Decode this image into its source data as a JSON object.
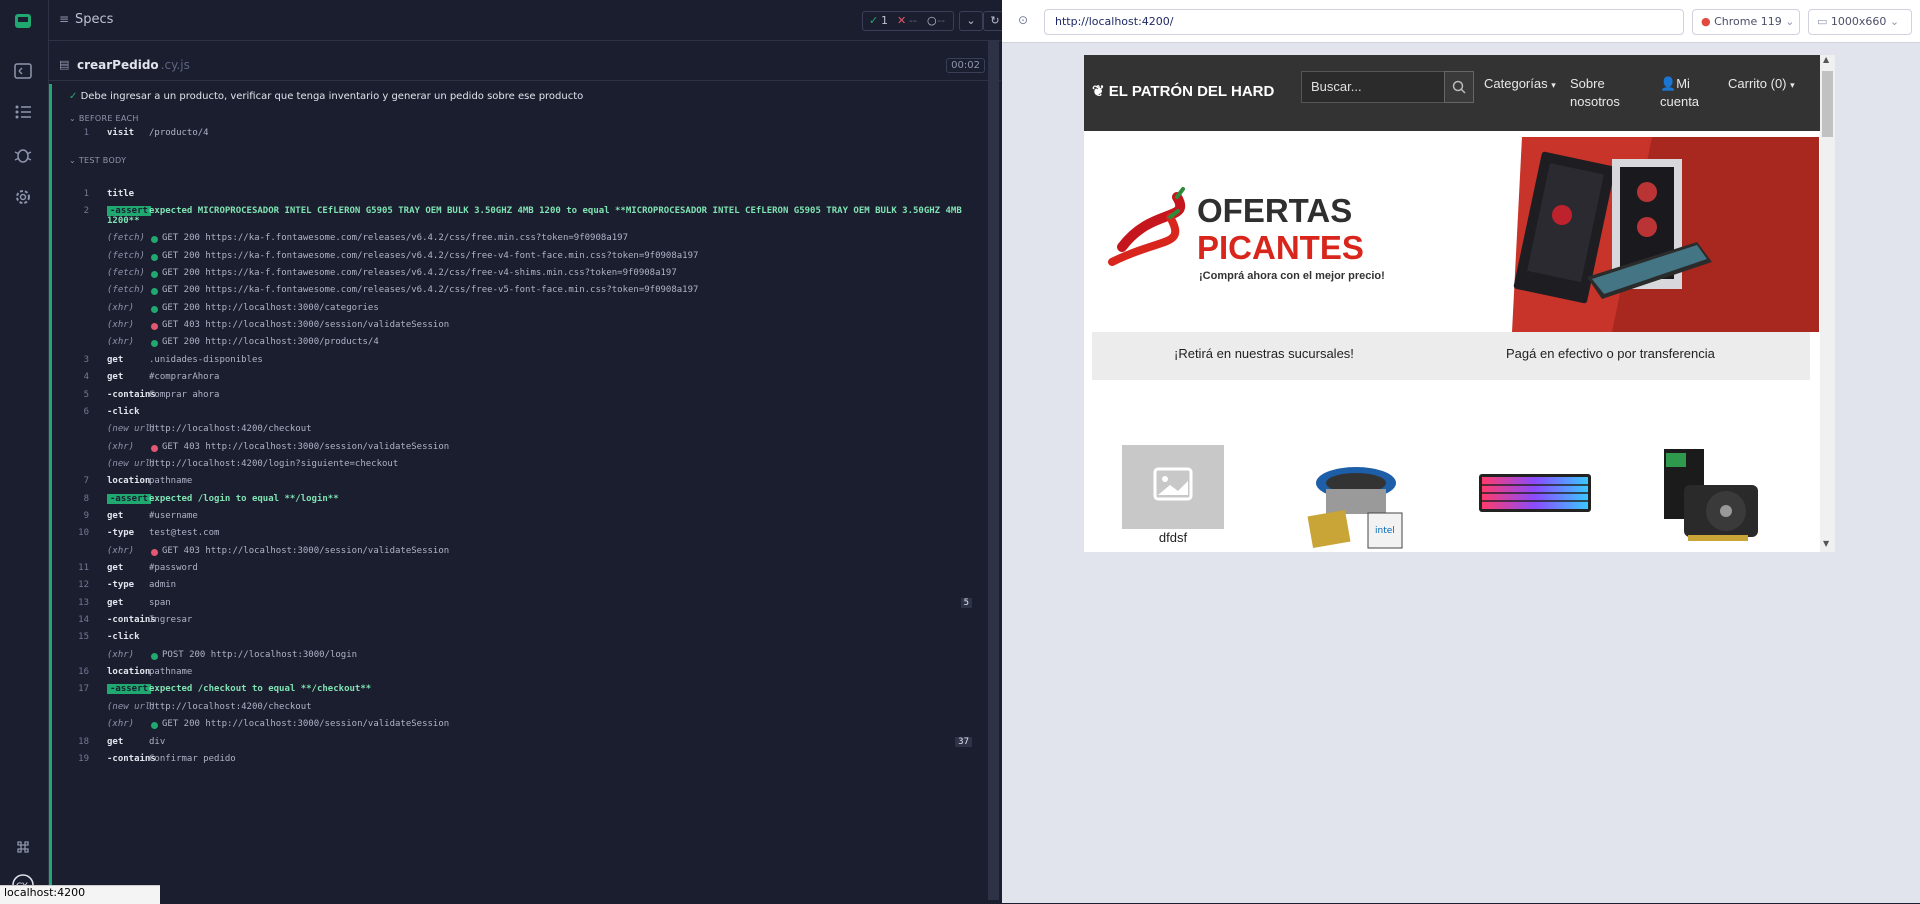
{
  "sidenav": {
    "items": [
      "logo",
      "specs",
      "runs",
      "debug",
      "settings",
      "keyboard",
      "cypress-logo"
    ]
  },
  "specs_bar": {
    "title": "Specs",
    "passed": "1",
    "failed": "--",
    "pending": "--"
  },
  "file": {
    "name": "crearPedido",
    "ext": ".cy.js",
    "duration": "00:02"
  },
  "test": {
    "title": "Debe ingresar a un producto, verificar que tenga inventario y generar un pedido sobre ese producto"
  },
  "sections": {
    "before_each": "BEFORE EACH",
    "test_body": "TEST BODY"
  },
  "commands": [
    {
      "num": "1",
      "name": "visit",
      "msg": "/producto/4",
      "sub": false
    },
    {
      "num": "1",
      "name": "title",
      "msg": "",
      "sub": false
    },
    {
      "num": "2",
      "name": "-assert",
      "msg": "expected MICROPROCESADOR INTEL CEfLERON G5905 TRAY OEM BULK 3.50GHZ 4MB 1200 to equal **MICROPROCESADOR INTEL CEfLERON G5905 TRAY OEM BULK 3.50GHZ 4MB",
      "msg2": "1200**",
      "sub": false
    },
    {
      "num": "",
      "name": "(fetch)",
      "msg": "GET 200 https://ka-f.fontawesome.com/releases/v6.4.2/css/free.min.css?token=9f0908a197",
      "sub": true,
      "dot": "#1fa971"
    },
    {
      "num": "",
      "name": "(fetch)",
      "msg": "GET 200 https://ka-f.fontawesome.com/releases/v6.4.2/css/free-v4-font-face.min.css?token=9f0908a197",
      "sub": true,
      "dot": "#1fa971"
    },
    {
      "num": "",
      "name": "(fetch)",
      "msg": "GET 200 https://ka-f.fontawesome.com/releases/v6.4.2/css/free-v4-shims.min.css?token=9f0908a197",
      "sub": true,
      "dot": "#1fa971"
    },
    {
      "num": "",
      "name": "(fetch)",
      "msg": "GET 200 https://ka-f.fontawesome.com/releases/v6.4.2/css/free-v5-font-face.min.css?token=9f0908a197",
      "sub": true,
      "dot": "#1fa971"
    },
    {
      "num": "",
      "name": "(xhr)",
      "msg": "GET 200 http://localhost:3000/categories",
      "sub": true,
      "dot": "#1fa971"
    },
    {
      "num": "",
      "name": "(xhr)",
      "msg": "GET 403 http://localhost:3000/session/validateSession",
      "sub": true,
      "dot": "#e45770"
    },
    {
      "num": "",
      "name": "(xhr)",
      "msg": "GET 200 http://localhost:3000/products/4",
      "sub": true,
      "dot": "#1fa971"
    },
    {
      "num": "3",
      "name": "get",
      "msg": ".unidades-disponibles",
      "sub": false
    },
    {
      "num": "4",
      "name": "get",
      "msg": "#comprarAhora",
      "sub": false
    },
    {
      "num": "5",
      "name": "-contains",
      "msg": "Comprar ahora",
      "sub": false
    },
    {
      "num": "6",
      "name": "-click",
      "msg": "",
      "sub": false
    },
    {
      "num": "",
      "name": "(new url)",
      "msg": "http://localhost:4200/checkout",
      "sub": true
    },
    {
      "num": "",
      "name": "(xhr)",
      "msg": "GET 403 http://localhost:3000/session/validateSession",
      "sub": true,
      "dot": "#e45770"
    },
    {
      "num": "",
      "name": "(new url)",
      "msg": "http://localhost:4200/login?siguiente=checkout",
      "sub": true
    },
    {
      "num": "7",
      "name": "location",
      "msg": "pathname",
      "sub": false
    },
    {
      "num": "8",
      "name": "-assert",
      "msg": "expected /login to equal **/login**",
      "sub": false
    },
    {
      "num": "9",
      "name": "get",
      "msg": "#username",
      "sub": false
    },
    {
      "num": "10",
      "name": "-type",
      "msg": "test@test.com",
      "sub": false
    },
    {
      "num": "",
      "name": "(xhr)",
      "msg": "GET 403 http://localhost:3000/session/validateSession",
      "sub": true,
      "dot": "#e45770"
    },
    {
      "num": "11",
      "name": "get",
      "msg": "#password",
      "sub": false
    },
    {
      "num": "12",
      "name": "-type",
      "msg": "admin",
      "sub": false
    },
    {
      "num": "13",
      "name": "get",
      "msg": "span",
      "sub": false,
      "badge": "5"
    },
    {
      "num": "14",
      "name": "-contains",
      "msg": "Ingresar",
      "sub": false
    },
    {
      "num": "15",
      "name": "-click",
      "msg": "",
      "sub": false
    },
    {
      "num": "",
      "name": "(xhr)",
      "msg": "POST 200 http://localhost:3000/login",
      "sub": true,
      "dot": "#1fa971"
    },
    {
      "num": "16",
      "name": "location",
      "msg": "pathname",
      "sub": false
    },
    {
      "num": "17",
      "name": "-assert",
      "msg": "expected /checkout to equal **/checkout**",
      "sub": false
    },
    {
      "num": "",
      "name": "(new url)",
      "msg": "http://localhost:4200/checkout",
      "sub": true
    },
    {
      "num": "",
      "name": "(xhr)",
      "msg": "GET 200 http://localhost:3000/session/validateSession",
      "sub": true,
      "dot": "#1fa971"
    },
    {
      "num": "18",
      "name": "get",
      "msg": "div",
      "sub": false,
      "badge": "37"
    },
    {
      "num": "19",
      "name": "-contains",
      "msg": "Confirmar pedido",
      "sub": false
    }
  ],
  "statusbar": {
    "text": "localhost:4200"
  },
  "aut": {
    "url": "http://localhost:4200/",
    "browser": "Chrome 119",
    "viewport": "1000x660"
  },
  "site": {
    "brand": "EL PATRÓN DEL HARD",
    "search_placeholder": "Buscar...",
    "nav": {
      "categorias": "Categorías",
      "sobre": "Sobre",
      "nosotros": "nosotros",
      "mi": "Mi",
      "cuenta": "cuenta",
      "carrito": "Carrito (0)"
    },
    "banner": {
      "line1": "OFERTAS",
      "line2": "PICANTES",
      "tagline": "¡Comprá ahora con el mejor precio!"
    },
    "benefits": [
      "¡Retirá en nuestras sucursales!",
      "Pagá en efectivo o por transferencia"
    ],
    "products": [
      {
        "name": "dfdsf"
      }
    ]
  },
  "colors": {
    "accent": "#1fa971",
    "error": "#e45770",
    "nav_bg": "#333333",
    "banner_red": "#c8342a"
  }
}
